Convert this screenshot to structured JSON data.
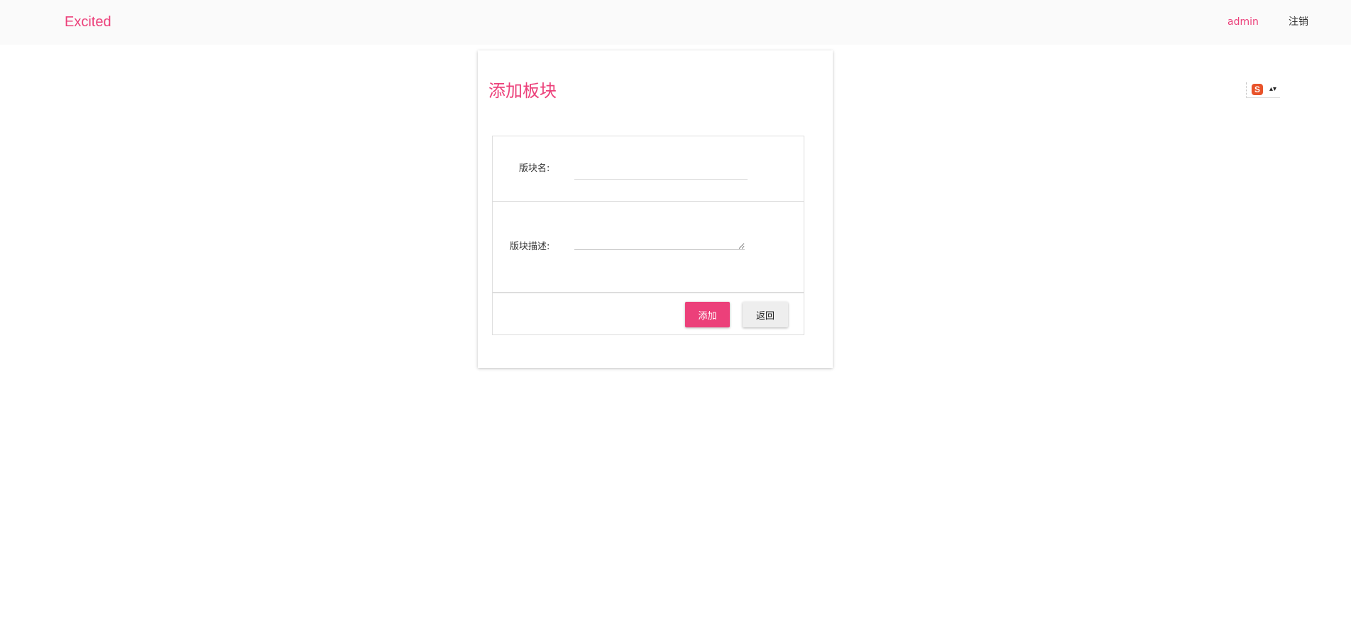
{
  "header": {
    "brand": "Excited",
    "user": "admin",
    "logout": "注销"
  },
  "card": {
    "title": "添加板块"
  },
  "form": {
    "name_label": "版块名:",
    "name_value": "",
    "desc_label": "版块描述:",
    "desc_value": "",
    "add_label": "添加",
    "back_label": "返回"
  },
  "ime": {
    "logo": "S",
    "arrow": "▴▾"
  },
  "colors": {
    "accent": "#ec407a",
    "topbar_bg": "#fafafa",
    "border": "#dddddd",
    "button_secondary": "#eeeeee"
  }
}
